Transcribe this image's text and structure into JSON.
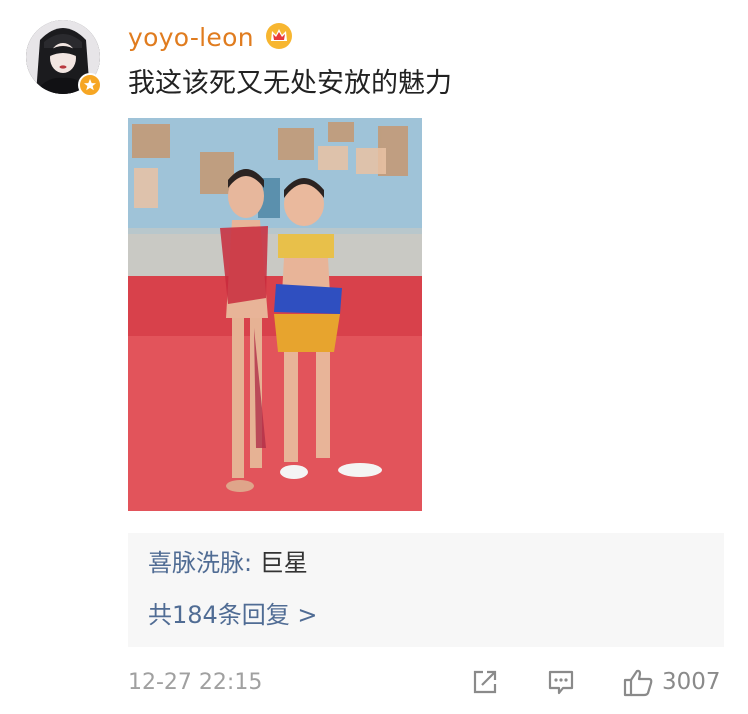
{
  "comment": {
    "username": "yoyo-leon",
    "text": "我这该死又无处安放的魅力",
    "badge_color": "#f6a623",
    "username_color": "#e07c1f"
  },
  "reply_preview": {
    "author": "喜脉洗脉:",
    "content": "巨星",
    "count_label": "共184条回复 >",
    "link_color": "#506c94"
  },
  "footer": {
    "timestamp": "12-27 22:15",
    "like_count": "3007",
    "icons": [
      "share-icon",
      "reply-icon",
      "like-icon"
    ]
  }
}
